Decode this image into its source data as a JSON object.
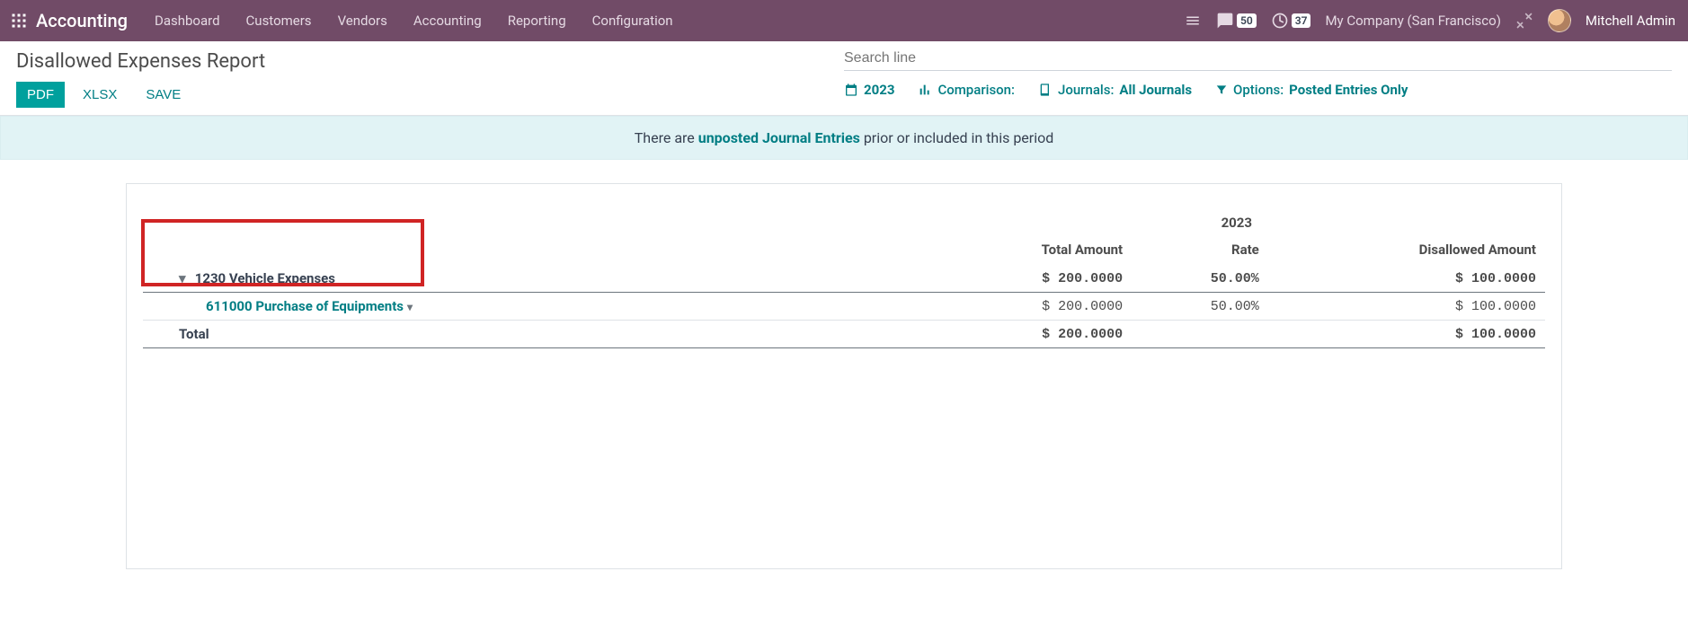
{
  "topbar": {
    "brand": "Accounting",
    "nav": [
      "Dashboard",
      "Customers",
      "Vendors",
      "Accounting",
      "Reporting",
      "Configuration"
    ],
    "messages_count": "50",
    "activities_count": "37",
    "company": "My Company (San Francisco)",
    "username": "Mitchell Admin"
  },
  "page": {
    "title": "Disallowed Expenses Report",
    "buttons": {
      "pdf": "PDF",
      "xlsx": "XLSX",
      "save": "SAVE"
    }
  },
  "search": {
    "placeholder": "Search line"
  },
  "filters": {
    "period": "2023",
    "comparison_label": "Comparison:",
    "journals_label": "Journals:",
    "journals_value": "All Journals",
    "options_label": "Options:",
    "options_value": "Posted Entries Only"
  },
  "warning": {
    "prefix": "There are ",
    "link": "unposted Journal Entries",
    "suffix": " prior or included in this period"
  },
  "table": {
    "year": "2023",
    "columns": {
      "total": "Total Amount",
      "rate": "Rate",
      "disallowed": "Disallowed Amount"
    },
    "row_main": {
      "label": "1230 Vehicle Expenses",
      "total": "$ 200.0000",
      "rate": "50.00%",
      "disallowed": "$ 100.0000"
    },
    "row_sub": {
      "label": "611000 Purchase of Equipments",
      "total": "$ 200.0000",
      "rate": "50.00%",
      "disallowed": "$ 100.0000"
    },
    "row_total": {
      "label": "Total",
      "total": "$ 200.0000",
      "rate": "",
      "disallowed": "$ 100.0000"
    }
  }
}
